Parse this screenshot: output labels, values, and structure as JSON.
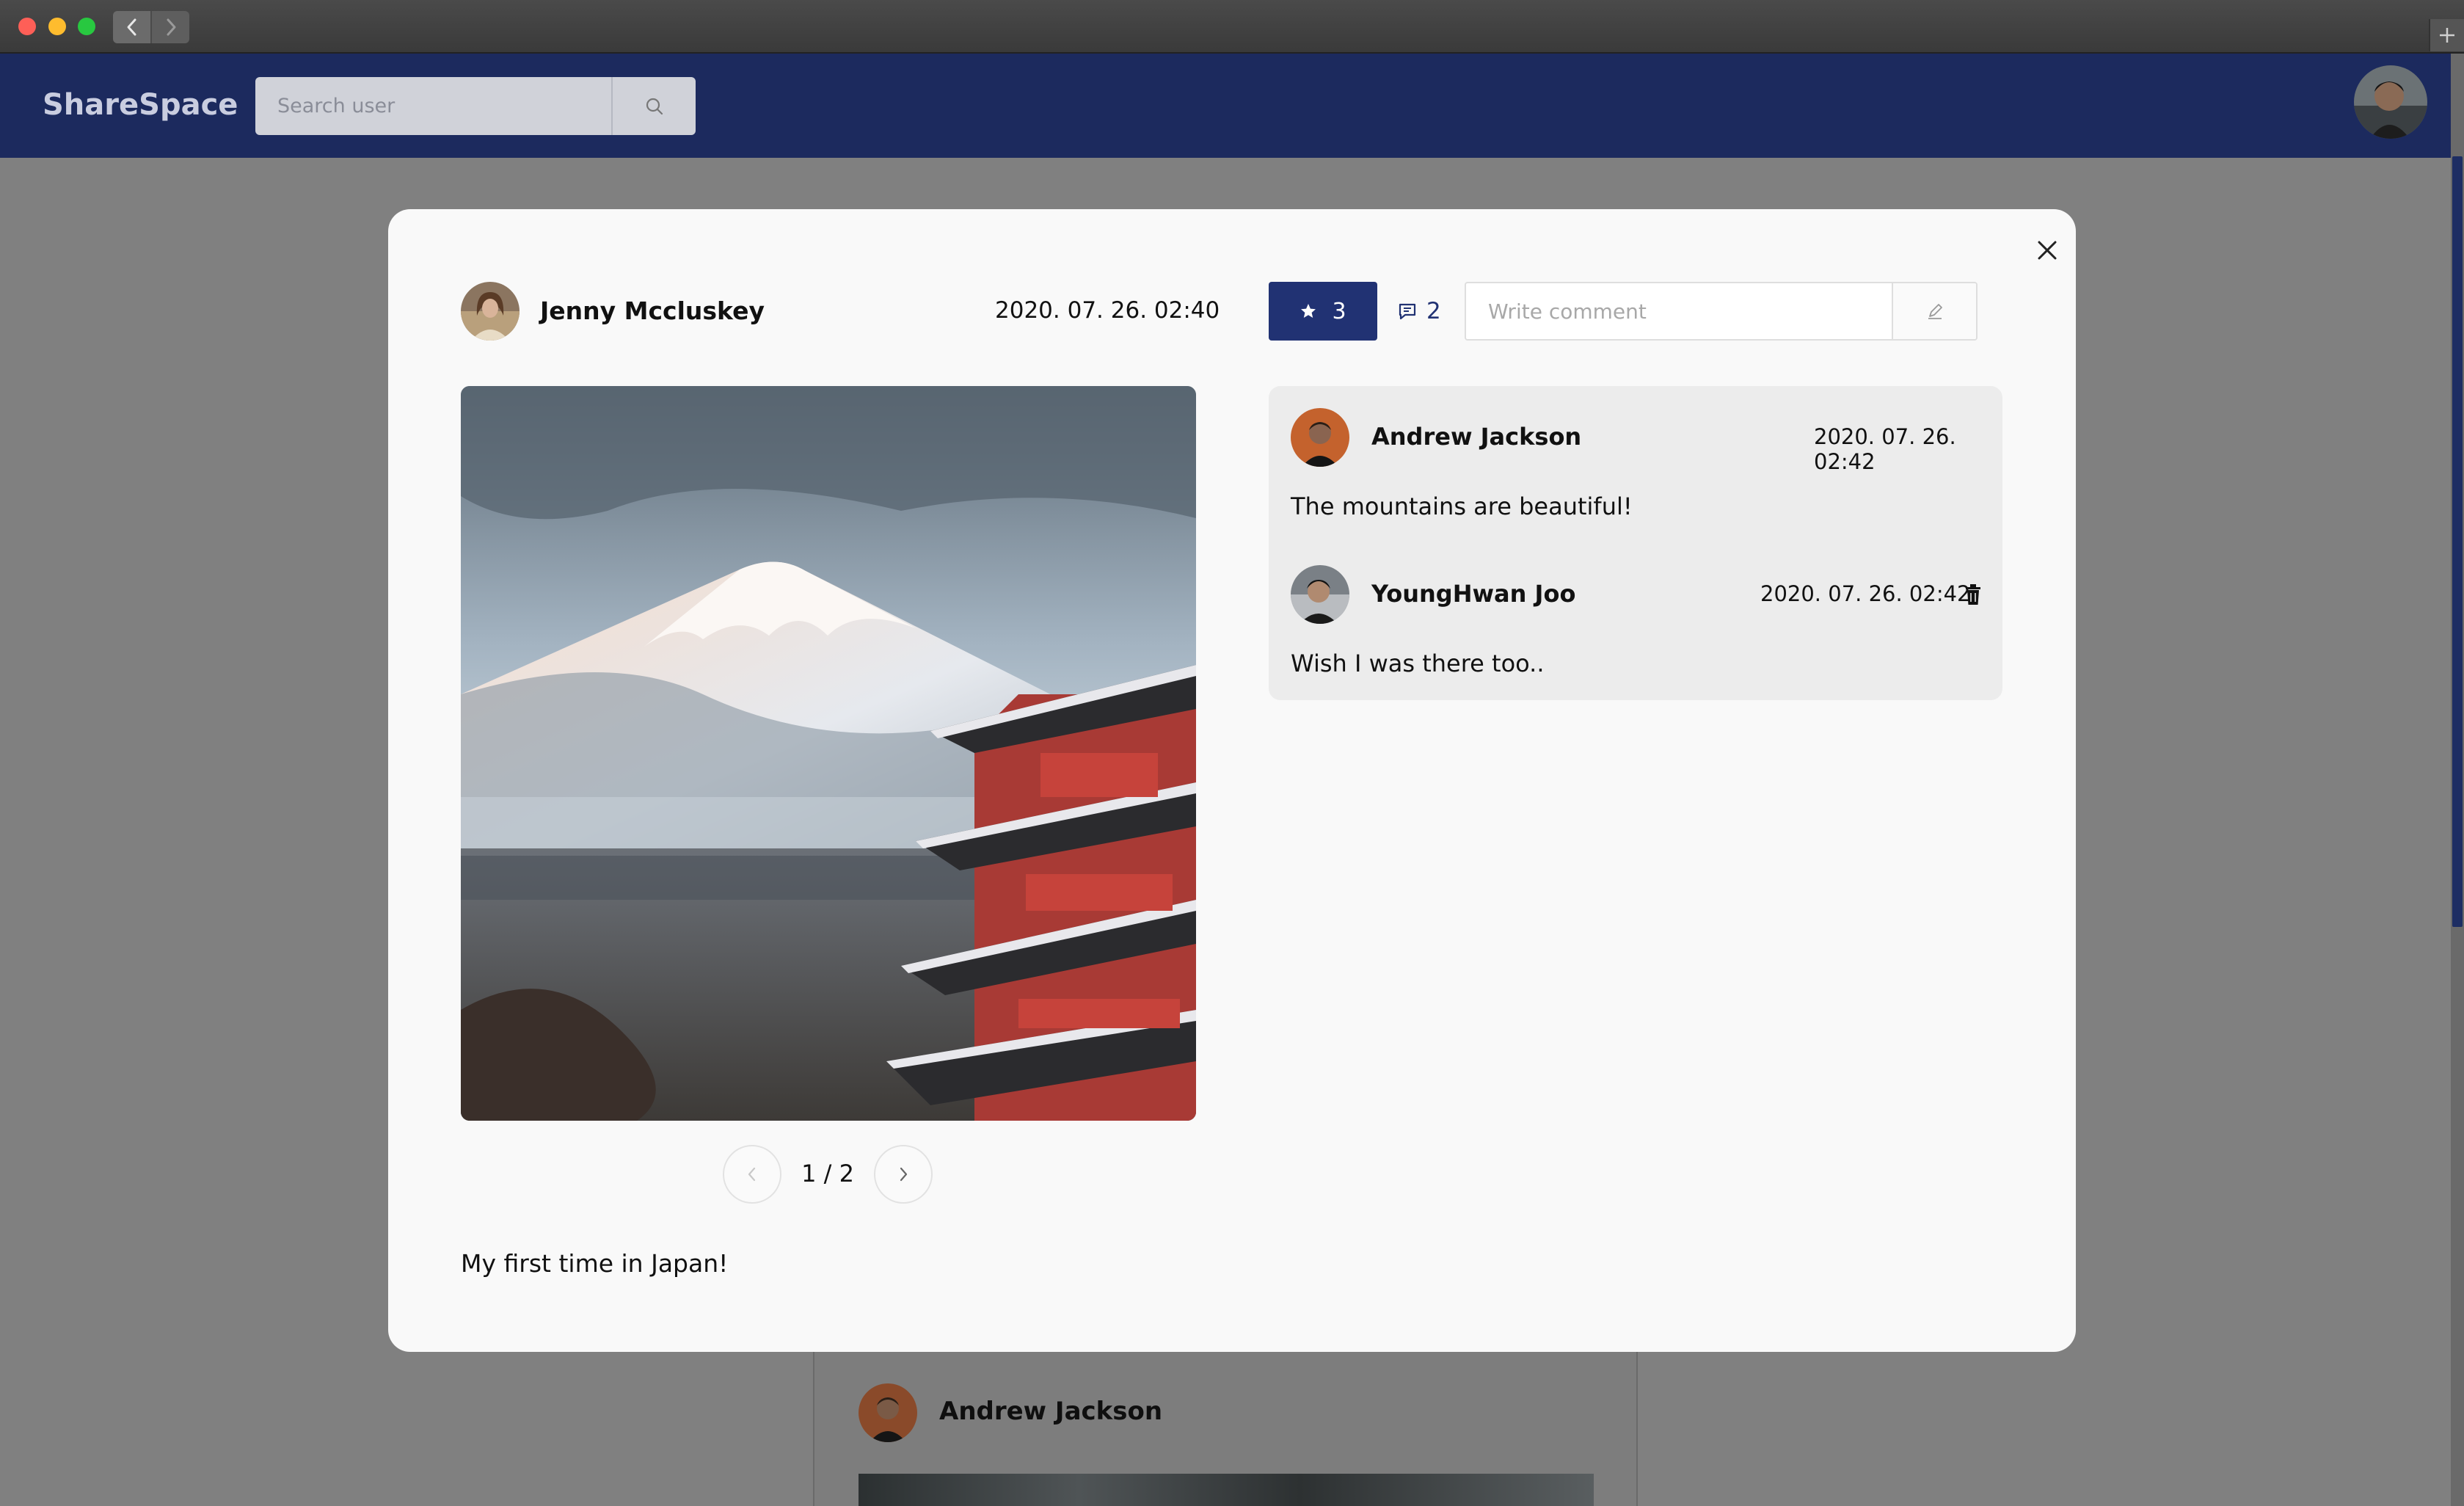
{
  "app": {
    "name": "ShareSpace",
    "search_placeholder": "Search user"
  },
  "post": {
    "author": "Jenny Mccluskey",
    "date": "2020. 07. 26. 02:40",
    "star_count": "3",
    "comment_count": "2",
    "comment_placeholder": "Write comment",
    "pager": "1 / 2",
    "caption": "My first time in Japan!"
  },
  "comments": [
    {
      "author": "Andrew Jackson",
      "date": "2020. 07. 26. 02:42",
      "text": "The mountains are beautiful!"
    },
    {
      "author": "YoungHwan Joo",
      "date": "2020. 07. 26. 02:42",
      "text": "Wish I was there too.."
    }
  ],
  "background_feed": {
    "author": "Andrew Jackson"
  },
  "icons": {
    "search": "search-icon",
    "star": "star-icon",
    "comment": "comment-icon",
    "pencil": "pencil-icon",
    "close": "close-icon",
    "trash": "trash-icon",
    "prev": "chevron-left-icon",
    "next": "chevron-right-icon"
  },
  "colors": {
    "header_bg": "#1c2a5e",
    "accent": "#213273",
    "overlay": "#808080",
    "modal_bg": "#f9f9f9",
    "comments_bg": "#ececec"
  }
}
